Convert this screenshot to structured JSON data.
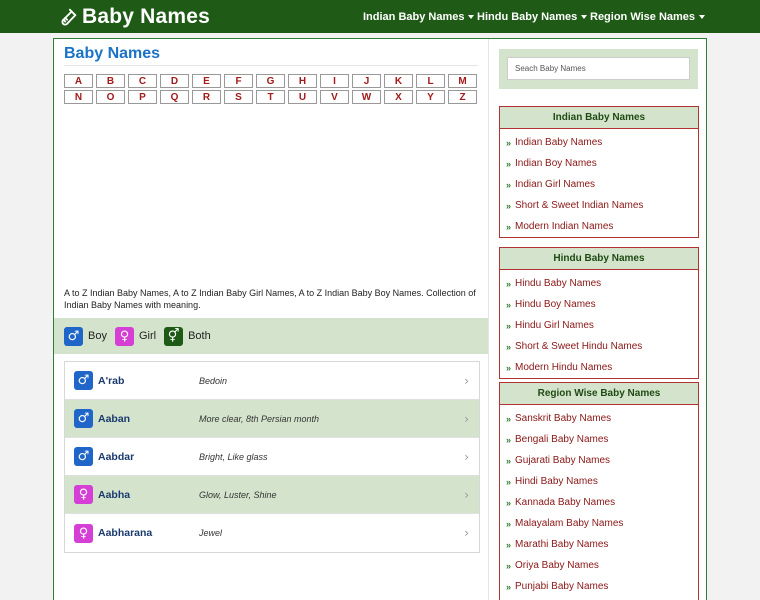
{
  "header": {
    "brand": "Baby Names",
    "nav": [
      {
        "label": "Indian Baby Names"
      },
      {
        "label": "Hindu Baby Names"
      },
      {
        "label": "Region Wise Names"
      }
    ]
  },
  "main": {
    "title": "Baby Names",
    "alphabet_row1": [
      "A",
      "B",
      "C",
      "D",
      "E",
      "F",
      "G",
      "H",
      "I",
      "J",
      "K",
      "L",
      "M"
    ],
    "alphabet_row2": [
      "N",
      "O",
      "P",
      "Q",
      "R",
      "S",
      "T",
      "U",
      "V",
      "W",
      "X",
      "Y",
      "Z"
    ],
    "intro": "A to Z Indian Baby Names, A to Z Indian Baby Girl Names, A to Z Indian Baby Boy Names. Collection of Indian Baby Names with meaning.",
    "filters": [
      {
        "label": "Boy",
        "symbol": "♂"
      },
      {
        "label": "Girl",
        "symbol": "♀"
      },
      {
        "label": "Both",
        "symbol": "⚥"
      }
    ],
    "names": [
      {
        "name": "A'rab",
        "meaning": "Bedoin",
        "gender": "boy",
        "symbol": "♂"
      },
      {
        "name": "Aaban",
        "meaning": "More clear, 8th Persian month",
        "gender": "boy",
        "symbol": "♂"
      },
      {
        "name": "Aabdar",
        "meaning": "Bright, Like glass",
        "gender": "boy",
        "symbol": "♂"
      },
      {
        "name": "Aabha",
        "meaning": "Glow, Luster, Shine",
        "gender": "girl",
        "symbol": "♀"
      },
      {
        "name": "Aabharana",
        "meaning": "Jewel",
        "gender": "girl",
        "symbol": "♀"
      }
    ],
    "chevron": "›"
  },
  "sidebar": {
    "search_placeholder": "Seach Baby Names",
    "bullet": "»",
    "panels": [
      {
        "title": "Indian Baby Names",
        "links": [
          "Indian Baby Names",
          "Indian Boy Names",
          "Indian Girl Names",
          "Short & Sweet Indian Names",
          "Modern Indian Names"
        ]
      },
      {
        "title": "Hindu Baby Names",
        "links": [
          "Hindu Baby Names",
          "Hindu Boy Names",
          "Hindu Girl Names",
          "Short & Sweet Hindu Names",
          "Modern Hindu Names"
        ]
      },
      {
        "title": "Region Wise Baby Names",
        "links": [
          "Sanskrit Baby Names",
          "Bengali Baby Names",
          "Gujarati Baby Names",
          "Hindi Baby Names",
          "Kannada Baby Names",
          "Malayalam Baby Names",
          "Marathi Baby Names",
          "Oriya Baby Names",
          "Punjabi Baby Names"
        ]
      }
    ]
  },
  "colors": {
    "header_bg": "#1f5a16",
    "accent_green_light": "#d4e4cc",
    "title_blue": "#1a73c7",
    "link_red": "#8a1616",
    "boy": "#1f66c8",
    "girl": "#d63fd6",
    "both": "#1c5a16"
  },
  "icons": {
    "brand": "baby-bottle-icon",
    "boy": "male-symbol-icon",
    "girl": "female-symbol-icon",
    "both": "unisex-symbol-icon",
    "row_arrow": "chevron-right-icon"
  }
}
